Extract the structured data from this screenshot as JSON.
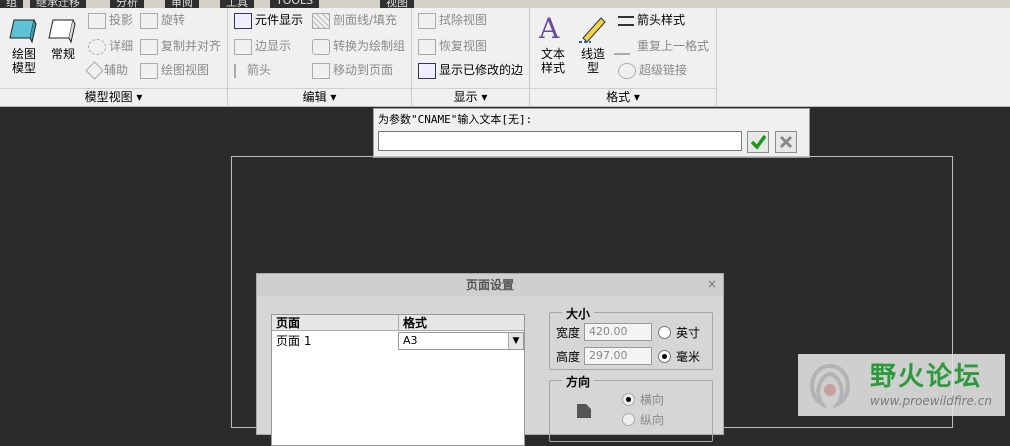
{
  "tabs": [
    "组",
    "继承迁移",
    "分析",
    "审阅",
    "工具",
    "TOOLS",
    "视图"
  ],
  "ribbon": {
    "groups": [
      "模型视图 ▾",
      "编辑 ▾",
      "显示 ▾",
      "格式 ▾"
    ],
    "model_views": {
      "big_btn1": "绘图\n模型",
      "big_btn2": "常规",
      "small": [
        "投影",
        "旋转",
        "详细",
        "复制并对齐",
        "辅助",
        "绘图视图"
      ]
    },
    "edit": {
      "col1": [
        "元件显示",
        "边显示",
        "箭头"
      ],
      "col2": [
        "剖面线/填充",
        "转换为绘制组",
        "移动到页面"
      ]
    },
    "display": [
      "拭除视图",
      "恢复视图",
      "显示已修改的边"
    ],
    "format": {
      "big_btn1": "文本\n样式",
      "big_btn2": "线造\n型",
      "small": [
        "箭头样式",
        "重复上一格式",
        "超级链接"
      ]
    }
  },
  "cmdbar": {
    "prompt": "为参数\"CNAME\"输入文本[无]:",
    "value": ""
  },
  "dialog": {
    "title": "页面设置",
    "close": "×",
    "table_headers": [
      "页面",
      "格式"
    ],
    "row_page": "页面 1",
    "row_format": "A3",
    "size_legend": "大小",
    "width_label": "宽度",
    "width_value": "420.00",
    "height_label": "高度",
    "height_value": "297.00",
    "unit_inch": "英寸",
    "unit_mm": "毫米",
    "orient_legend": "方向",
    "orient_landscape": "横向",
    "orient_portrait": "纵向"
  },
  "watermark": {
    "title": "野火论坛",
    "url": "www.proewildfire.cn"
  }
}
